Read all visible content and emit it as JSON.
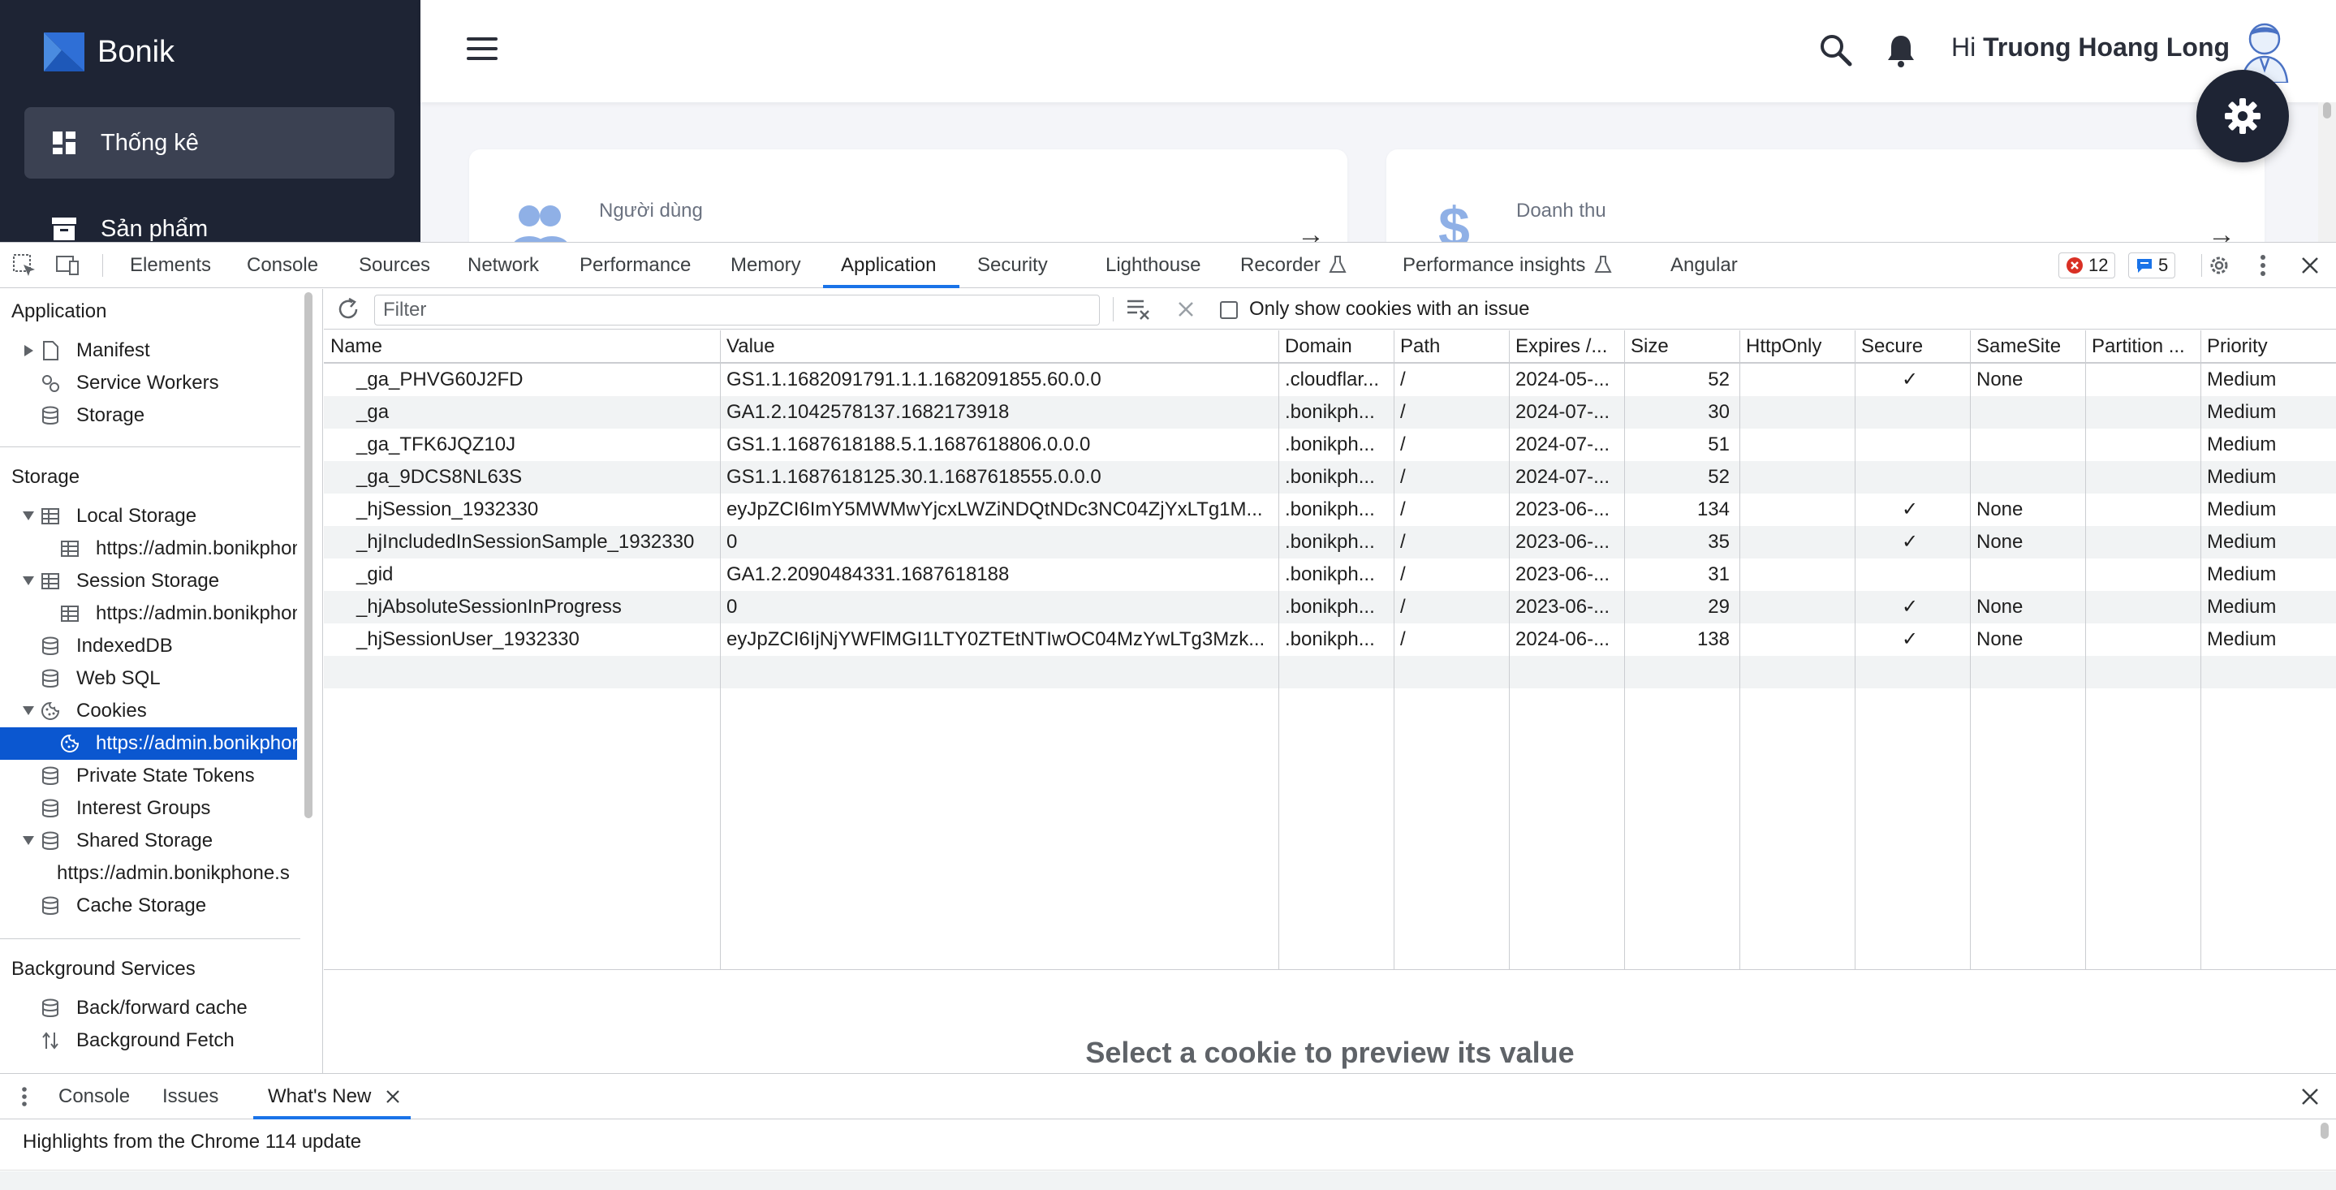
{
  "app": {
    "brand": "Bonik",
    "sidebar": [
      {
        "label": "Thống kê",
        "icon": "dashboard-icon",
        "active": true
      },
      {
        "label": "Sản phẩm",
        "icon": "archive-icon",
        "active": false
      }
    ],
    "header": {
      "greeting_prefix": "Hi",
      "user_name": "Truong Hoang Long"
    },
    "cards": [
      {
        "label": "Người dùng",
        "icon": "users-icon"
      },
      {
        "label": "Doanh thu",
        "icon": "dollar-icon"
      }
    ],
    "colors": {
      "sidebar_bg": "#1e2434",
      "accent": "#4a72c4"
    }
  },
  "devtools": {
    "tabs": [
      "Elements",
      "Console",
      "Sources",
      "Network",
      "Performance",
      "Memory",
      "Application",
      "Security",
      "Lighthouse",
      "Recorder",
      "Performance insights",
      "Angular"
    ],
    "active_tab": "Application",
    "error_count": "12",
    "message_count": "5",
    "left_panel": {
      "sections": {
        "application": "Application",
        "storage": "Storage",
        "background": "Background Services"
      },
      "application_items": [
        "Manifest",
        "Service Workers",
        "Storage"
      ],
      "storage_items": {
        "local_storage": "Local Storage",
        "local_storage_child": "https://admin.bonikphone.s",
        "session_storage": "Session Storage",
        "session_storage_child": "https://admin.bonikphone.s",
        "indexeddb": "IndexedDB",
        "websql": "Web SQL",
        "cookies": "Cookies",
        "cookies_child": "https://admin.bonikphone.s",
        "private_state_tokens": "Private State Tokens",
        "interest_groups": "Interest Groups",
        "shared_storage": "Shared Storage",
        "shared_storage_child": "https://admin.bonikphone.s",
        "cache_storage": "Cache Storage"
      },
      "background_items": [
        "Back/forward cache",
        "Background Fetch"
      ]
    },
    "toolbar": {
      "filter_placeholder": "Filter",
      "only_issues_label": "Only show cookies with an issue"
    },
    "columns": [
      "Name",
      "Value",
      "Domain",
      "Path",
      "Expires /...",
      "Size",
      "HttpOnly",
      "Secure",
      "SameSite",
      "Partition ...",
      "Priority"
    ],
    "cookies": [
      [
        "_ga_PHVG60J2FD",
        "GS1.1.1682091791.1.1.1682091855.60.0.0",
        ".cloudflar...",
        "/",
        "2024-05-...",
        "52",
        "",
        "✓",
        "None",
        "",
        "Medium"
      ],
      [
        "_ga",
        "GA1.2.1042578137.1682173918",
        ".bonikph...",
        "/",
        "2024-07-...",
        "30",
        "",
        "",
        "",
        "",
        "Medium"
      ],
      [
        "_ga_TFK6JQZ10J",
        "GS1.1.1687618188.5.1.1687618806.0.0.0",
        ".bonikph...",
        "/",
        "2024-07-...",
        "51",
        "",
        "",
        "",
        "",
        "Medium"
      ],
      [
        "_ga_9DCS8NL63S",
        "GS1.1.1687618125.30.1.1687618555.0.0.0",
        ".bonikph...",
        "/",
        "2024-07-...",
        "52",
        "",
        "",
        "",
        "",
        "Medium"
      ],
      [
        "_hjSession_1932330",
        "eyJpZCI6ImY5MWMwYjcxLWZiNDQtNDc3NC04ZjYxLTg1M...",
        ".bonikph...",
        "/",
        "2023-06-...",
        "134",
        "",
        "✓",
        "None",
        "",
        "Medium"
      ],
      [
        "_hjIncludedInSessionSample_1932330",
        "0",
        ".bonikph...",
        "/",
        "2023-06-...",
        "35",
        "",
        "✓",
        "None",
        "",
        "Medium"
      ],
      [
        "_gid",
        "GA1.2.2090484331.1687618188",
        ".bonikph...",
        "/",
        "2023-06-...",
        "31",
        "",
        "",
        "",
        "",
        "Medium"
      ],
      [
        "_hjAbsoluteSessionInProgress",
        "0",
        ".bonikph...",
        "/",
        "2023-06-...",
        "29",
        "",
        "✓",
        "None",
        "",
        "Medium"
      ],
      [
        "_hjSessionUser_1932330",
        "eyJpZCI6IjNjYWFlMGI1LTY0ZTEtNTIwOC04MzYwLTg3Mzk...",
        ".bonikph...",
        "/",
        "2024-06-...",
        "138",
        "",
        "✓",
        "None",
        "",
        "Medium"
      ]
    ],
    "preview_message": "Select a cookie to preview its value",
    "drawer": {
      "tabs": [
        "Console",
        "Issues",
        "What's New"
      ],
      "active_tab": "What's New",
      "message": "Highlights from the Chrome 114 update"
    }
  }
}
